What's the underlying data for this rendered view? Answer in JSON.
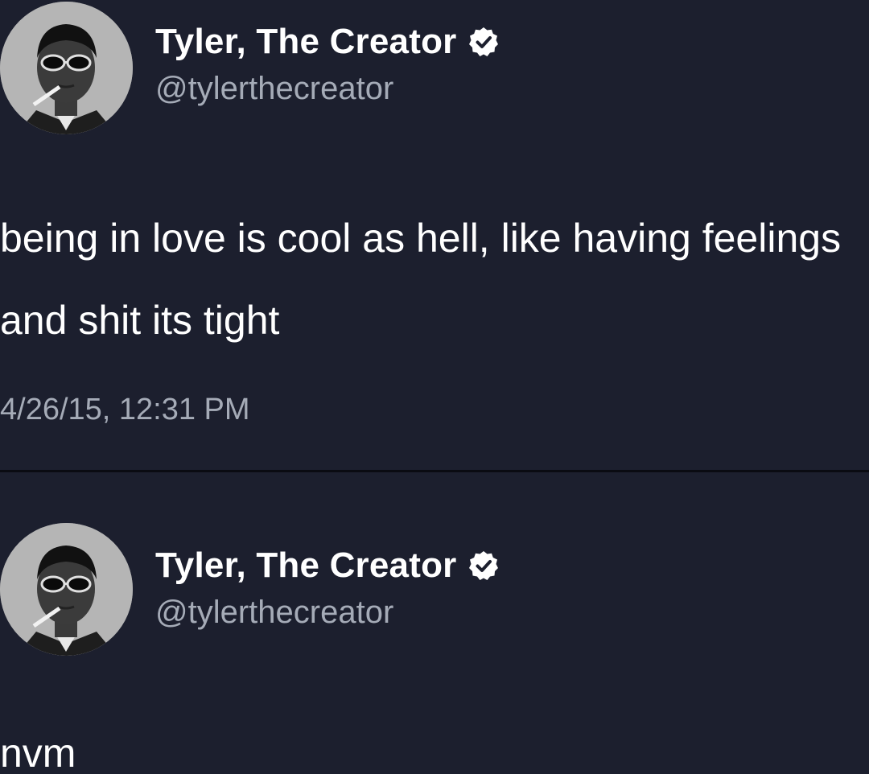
{
  "tweets": [
    {
      "author": {
        "display_name": "Tyler, The Creator",
        "handle": "@tylerthecreator",
        "verified": true
      },
      "text": "being in love is cool as hell, like having feelings and shit its tight",
      "timestamp": "4/26/15, 12:31 PM"
    },
    {
      "author": {
        "display_name": "Tyler, The Creator",
        "handle": "@tylerthecreator",
        "verified": true
      },
      "text": "nvm"
    }
  ],
  "colors": {
    "background": "#1c1f2e",
    "primary_text": "#ffffff",
    "secondary_text": "#a5abb7",
    "verified_badge": "#ffffff"
  }
}
